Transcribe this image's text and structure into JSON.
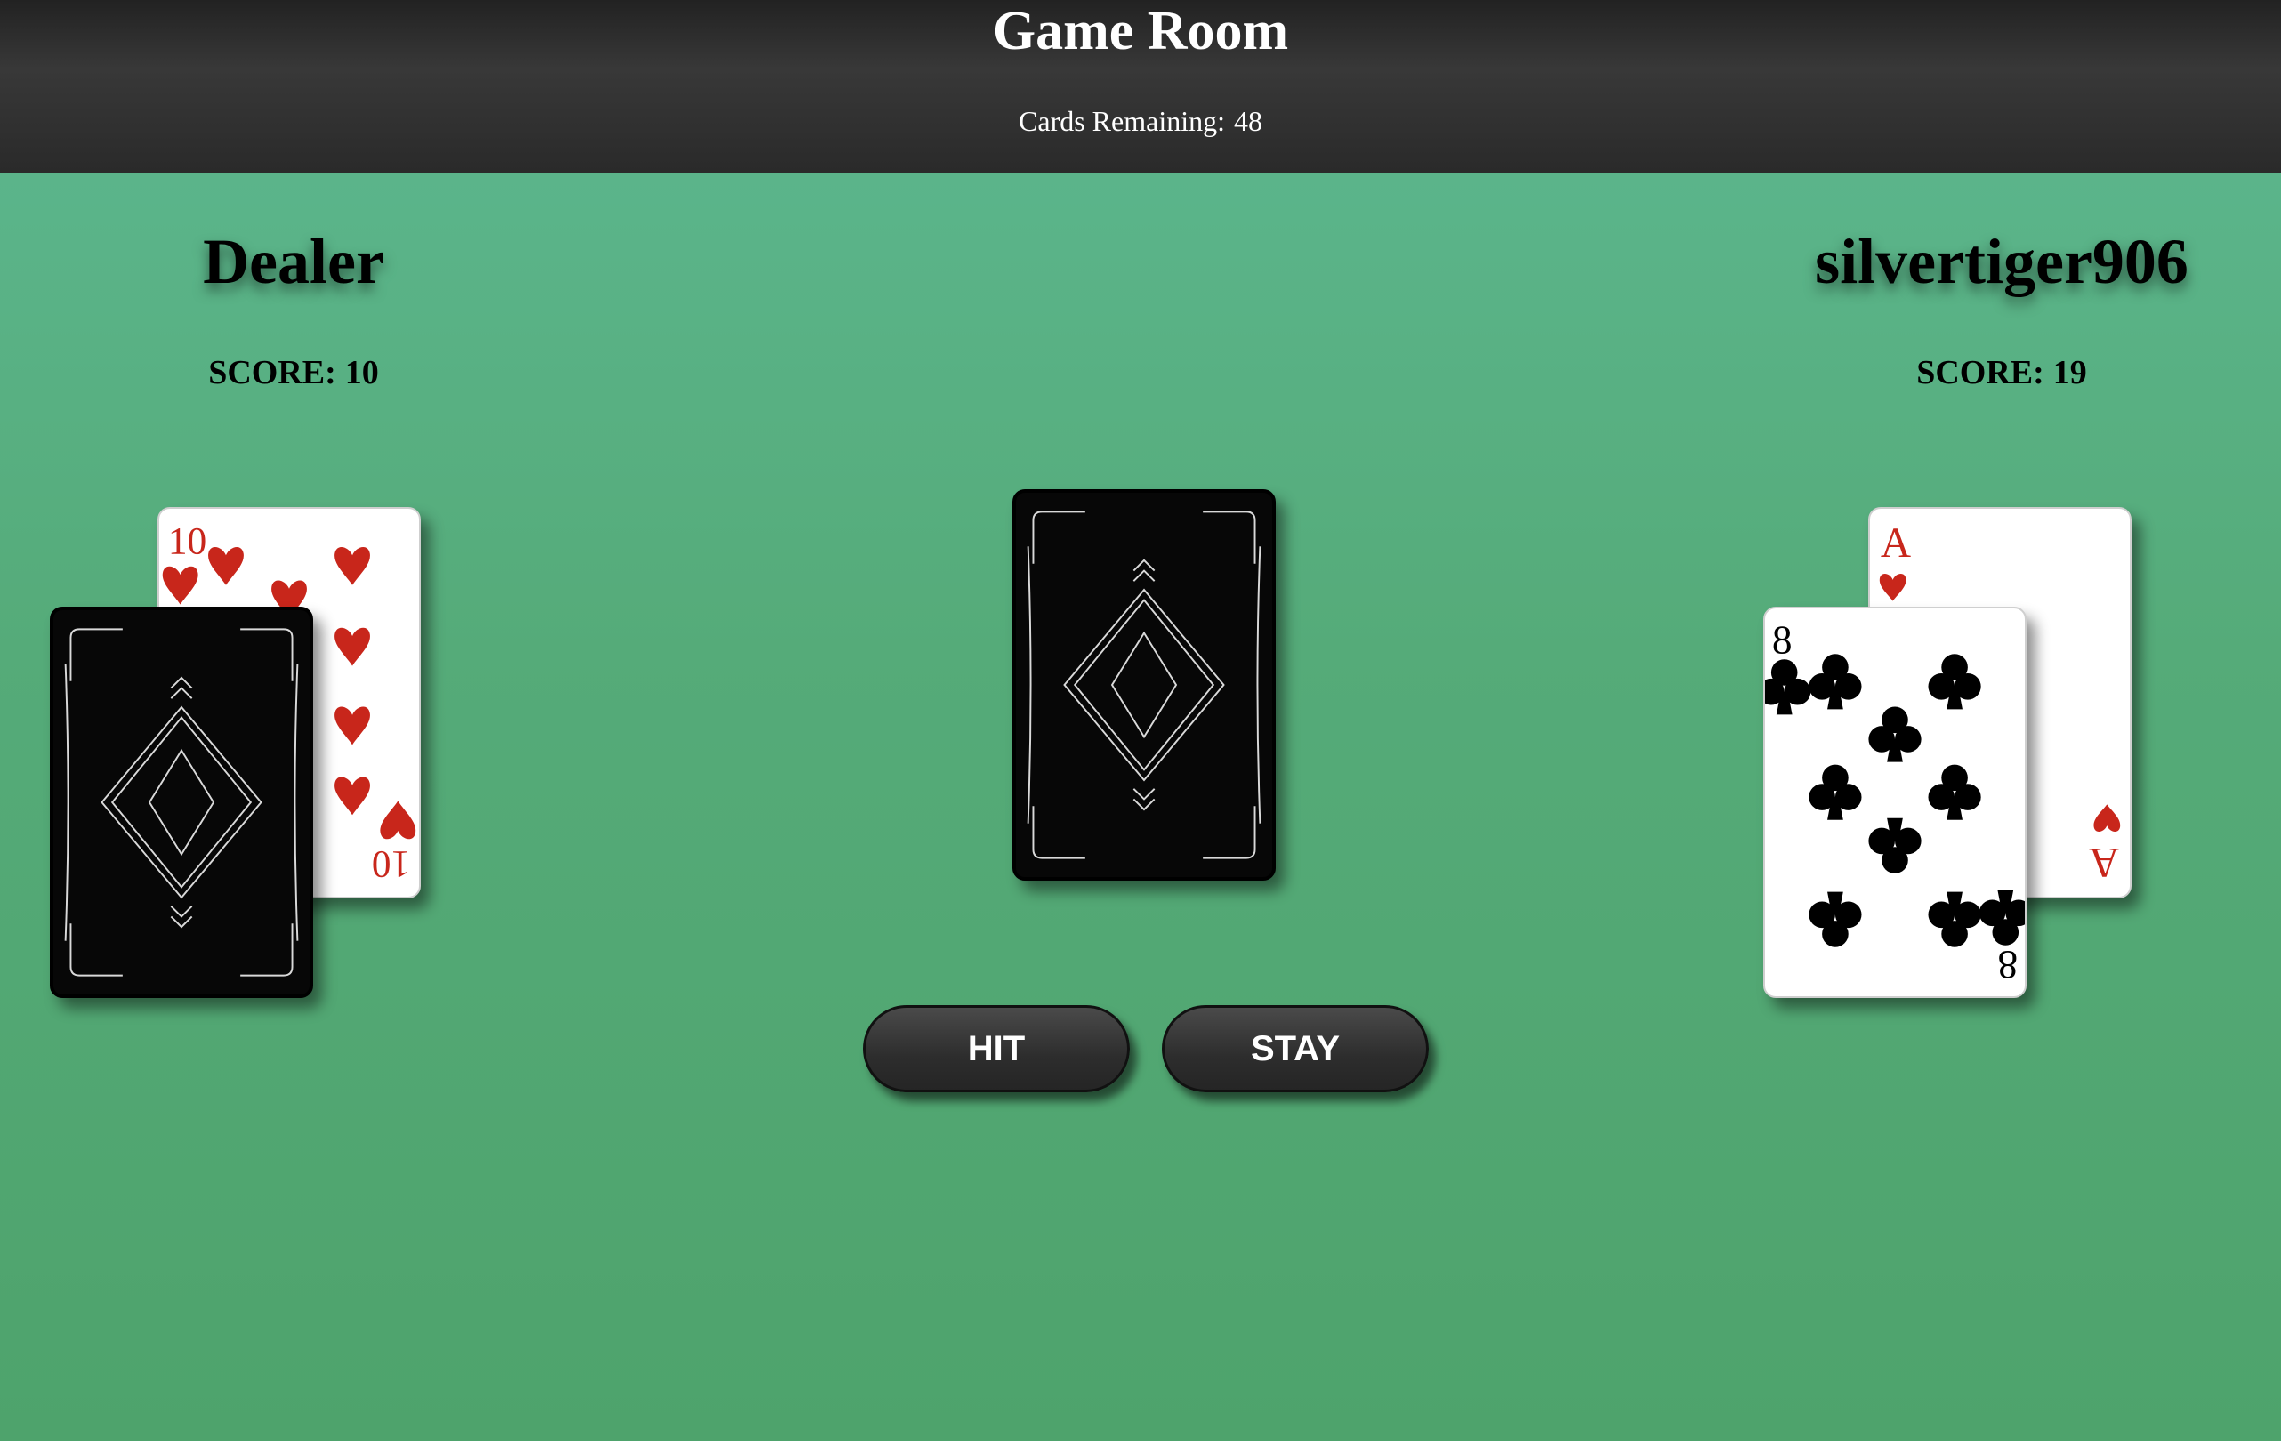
{
  "header": {
    "title": "Game Room",
    "remaining_label": "Cards Remaining:",
    "remaining_count": "48"
  },
  "dealer": {
    "name": "Dealer",
    "score_label": "SCORE:",
    "score": "10",
    "cards": [
      {
        "rank": "10",
        "suit": "hearts",
        "face_up": true
      },
      {
        "face_up": false
      }
    ]
  },
  "player": {
    "name": "silvertiger906",
    "score_label": "SCORE:",
    "score": "19",
    "cards": [
      {
        "rank": "A",
        "suit": "hearts",
        "face_up": true
      },
      {
        "rank": "8",
        "suit": "clubs",
        "face_up": true
      }
    ]
  },
  "deck": {
    "face_up": false
  },
  "actions": {
    "hit": "HIT",
    "stay": "STAY"
  },
  "colors": {
    "felt": "#55ab79",
    "header": "#2f2f2f",
    "red_suit": "#c8261b",
    "black_suit": "#000000"
  }
}
